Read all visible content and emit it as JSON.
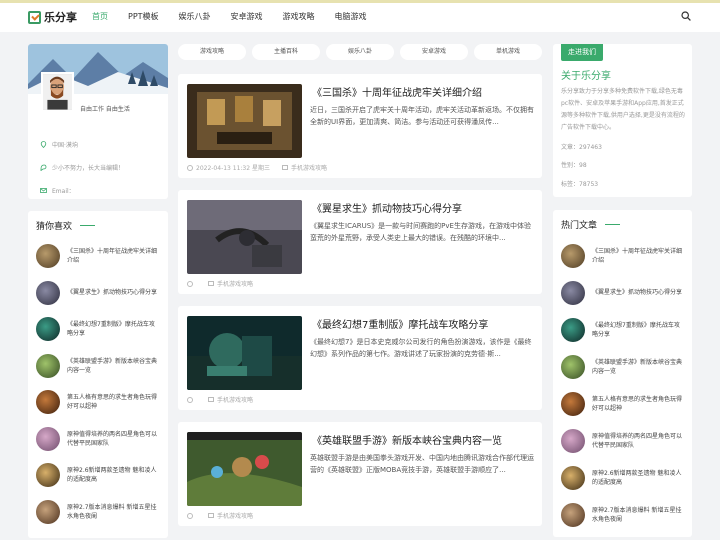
{
  "brand": {
    "name": "乐分享"
  },
  "nav": [
    "首页",
    "PPT模板",
    "娱乐八卦",
    "安卓游戏",
    "游戏攻略",
    "电脑游戏"
  ],
  "profile": {
    "tagline": "自由工作 自由生活",
    "location": "中国·漠垧",
    "motto": "少小不努力，长大当编辑！",
    "email": "Email："
  },
  "guess": {
    "title": "猜你喜欢",
    "items": [
      "《三国杀》十周年征战虎牢关详细介绍",
      "《翼星求生》抓动物技巧心得分享",
      "《最终幻想7重制版》摩托战车攻略分享",
      "《英雄联盟手游》新版本峡谷宝典内容一览",
      "第五人格有意思的求生者角色玩得好可以超神",
      "原神值得培养的两名四星角色可以代替平民国家队",
      "原神2.6新增两款圣遗物 魅和凌人的适配度高",
      "原神2.7版本消息爆料 新增五星挂水角色夜阑"
    ]
  },
  "tags": [
    "游戏攻略",
    "主播百科",
    "娱乐八卦",
    "安卓游戏",
    "单机游戏"
  ],
  "articles": [
    {
      "title": "《三国杀》十周年征战虎牢关详细介绍",
      "desc": "近日，三国杀开启了虎牢关十周年活动，虎牢关活动革新返场。不仅拥有全新的UI界面，更加清爽、简洁。参与活动还可获得潘凤传...",
      "date": "2022-04-13 11:32 星期三",
      "category": "手机游戏攻略"
    },
    {
      "title": "《翼星求生》抓动物技巧心得分享",
      "desc": "《翼星求生ICARUS》是一款与时间赛跑的PvE生存游戏，在游戏中体验蛮荒的外星荒野，承受人类史上最大的错误。在残酷的环境中...",
      "date": "",
      "category": "手机游戏攻略"
    },
    {
      "title": "《最终幻想7重制版》摩托战车攻略分享",
      "desc": "《最终幻想7》是日本史克威尔公司发行的角色扮演游戏，该作是《最终幻想》系列作品的第七作。游戏讲述了玩家扮演的克劳德·斯...",
      "date": "",
      "category": "手机游戏攻略"
    },
    {
      "title": "《英雄联盟手游》新版本峡谷宝典内容一览",
      "desc": "英雄联盟手游是由美国拳头游戏开发、中国内地由腾讯游戏合作部代理运营的《英雄联盟》正版MOBA竞技手游，英雄联盟手游顺应了...",
      "date": "",
      "category": "手机游戏攻略"
    }
  ],
  "about": {
    "follow": "走进我们",
    "title": "关于乐分享",
    "desc": "乐分享致力于分享多种免费软件下载,绿色无毒pc软件、安卓及苹果手游和App应用,首发正式源等多种软件下载,供用户选择,更是没有流程的广告软件下载中心。",
    "articles": "文章：297463",
    "comments": "性别：98",
    "tags": "标签：78753"
  },
  "hot": {
    "title": "热门文章",
    "items": [
      "《三国杀》十周年征战虎牢关详细介绍",
      "《翼星求生》抓动物技巧心得分享",
      "《最终幻想7重制版》摩托战车攻略分享",
      "《英雄联盟手游》新版本峡谷宝典内容一览",
      "第五人格有意思的求生者角色玩得好可以超神",
      "原神值得培养的两名四星角色可以代替平民国家队",
      "原神2.6新增两款圣遗物 魅和凌人的适配度高",
      "原神2.7版本消息爆料 新增五星挂水角色夜阑"
    ]
  },
  "colors": {
    "accent": "#3aaa6c"
  }
}
